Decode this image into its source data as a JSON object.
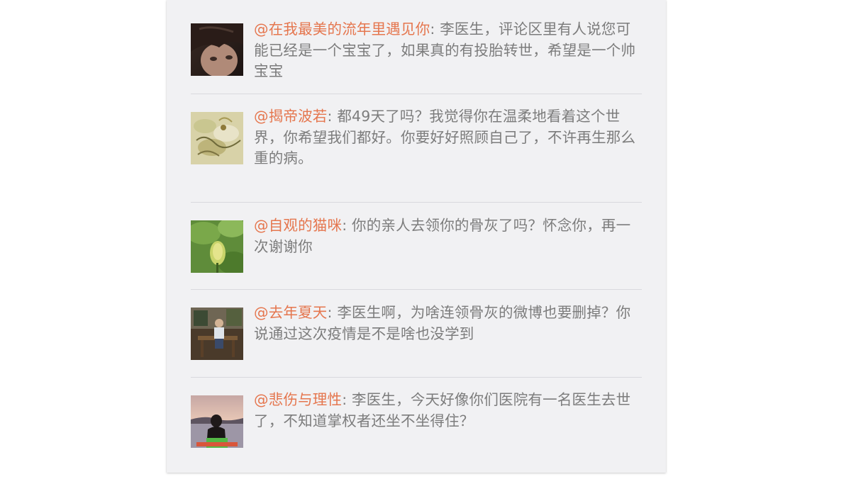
{
  "comments": [
    {
      "user": "@在我最美的流年里遇见你",
      "text": ": 李医生，评论区里有人说您可能已经是一个宝宝了，如果真的有投胎转世，希望是一个帅宝宝"
    },
    {
      "user": "@揭帝波若",
      "text": ": 都49天了吗？我觉得你在温柔地看着这个世界，你希望我们都好。你要好好照顾自己了，不许再生那么重的病。"
    },
    {
      "user": "@自观的猫咪",
      "text": ": 你的亲人去领你的骨灰了吗？怀念你，再一次谢谢你"
    },
    {
      "user": "@去年夏天",
      "text": ": 李医生啊，为啥连领骨灰的微博也要删掉？你说通过这次疫情是不是啥也没学到"
    },
    {
      "user": "@悲伤与理性",
      "text": ": 李医生，今天好像你们医院有一名医生去世了，不知道掌权者还坐不坐得住？"
    }
  ]
}
